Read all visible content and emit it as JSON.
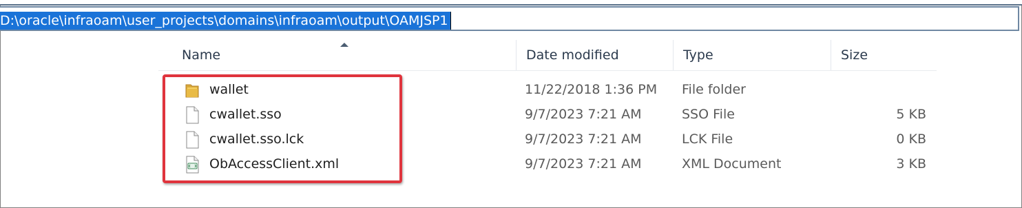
{
  "address_bar": {
    "path": "D:\\oracle\\infraoam\\user_projects\\domains\\infraoam\\output\\OAMJSP1"
  },
  "columns": {
    "name": "Name",
    "date_modified": "Date modified",
    "type": "Type",
    "size": "Size"
  },
  "sort": {
    "column": "Name",
    "direction": "ascending"
  },
  "files": [
    {
      "name": "wallet",
      "date": "11/22/2018 1:36 PM",
      "type": "File folder",
      "size": "",
      "icon": "folder-icon"
    },
    {
      "name": "cwallet.sso",
      "date": "9/7/2023 7:21 AM",
      "type": "SSO File",
      "size": "5 KB",
      "icon": "file-icon"
    },
    {
      "name": "cwallet.sso.lck",
      "date": "9/7/2023 7:21 AM",
      "type": "LCK File",
      "size": "0 KB",
      "icon": "file-icon"
    },
    {
      "name": "ObAccessClient.xml",
      "date": "9/7/2023 7:21 AM",
      "type": "XML Document",
      "size": "3 KB",
      "icon": "xml-file-icon"
    }
  ],
  "highlight": {
    "color": "#e0343d"
  },
  "colors": {
    "address_selection": "#1a73d8",
    "header_text": "#2b3a4d"
  }
}
